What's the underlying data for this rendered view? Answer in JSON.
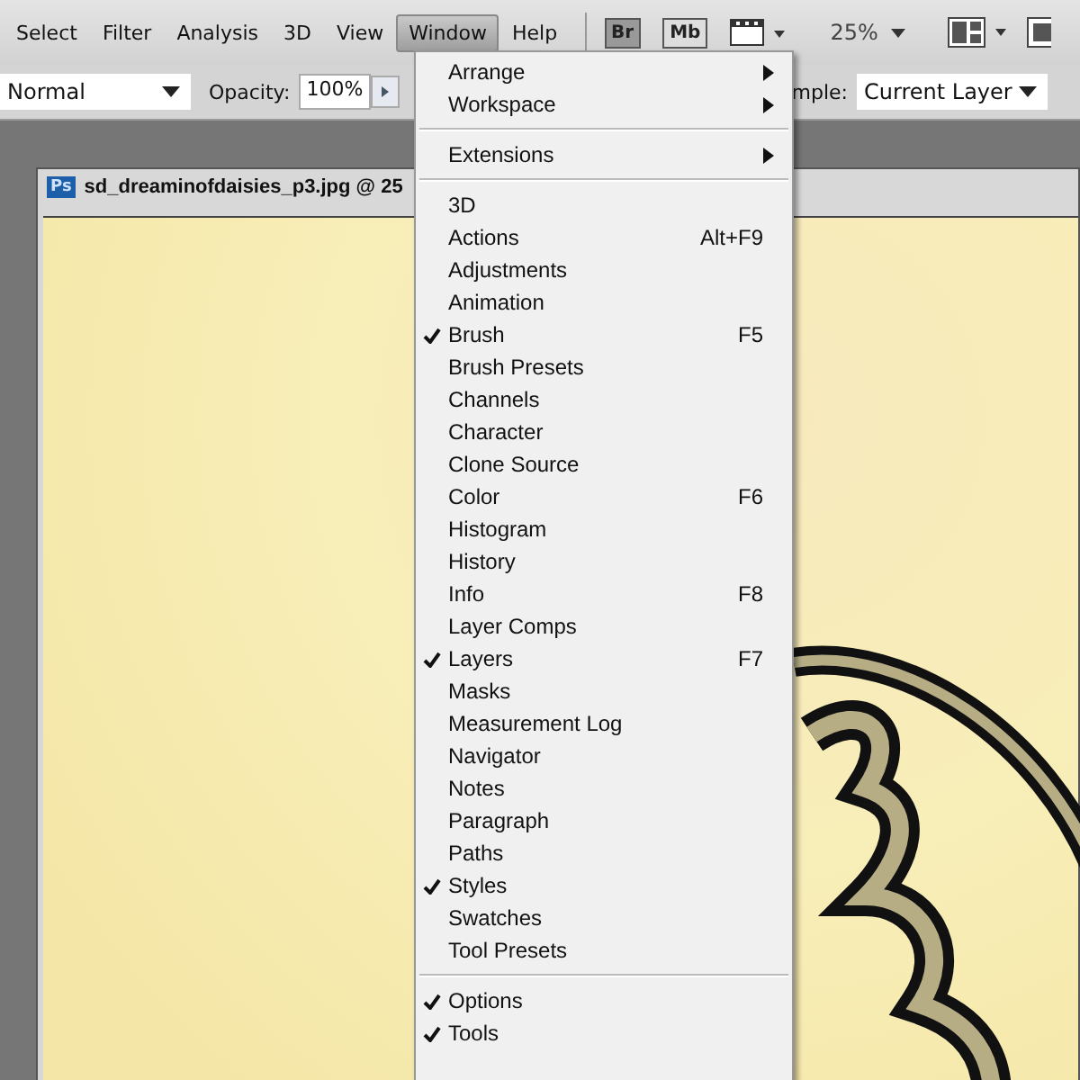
{
  "menubar": {
    "items": [
      {
        "label": "Select",
        "selected": false
      },
      {
        "label": "Filter",
        "selected": false
      },
      {
        "label": "Analysis",
        "selected": false
      },
      {
        "label": "3D",
        "selected": false
      },
      {
        "label": "View",
        "selected": false
      },
      {
        "label": "Window",
        "selected": true
      },
      {
        "label": "Help",
        "selected": false
      }
    ],
    "app_buttons": [
      "Br",
      "Mb"
    ],
    "zoom": "25%"
  },
  "options_bar": {
    "blend_mode": "Normal",
    "opacity_label": "Opacity:",
    "opacity": "100%",
    "sample_label": "mple:",
    "sample": "Current Layer"
  },
  "document": {
    "title": "sd_dreaminofdaisies_p3.jpg @ 25",
    "app_badge": "Ps"
  },
  "window_menu": {
    "items": [
      {
        "kind": "submenu",
        "label": "Arrange",
        "checked": false
      },
      {
        "kind": "submenu",
        "label": "Workspace",
        "checked": false
      },
      {
        "kind": "separator"
      },
      {
        "kind": "submenu",
        "label": "Extensions",
        "checked": false
      },
      {
        "kind": "separator"
      },
      {
        "kind": "item",
        "label": "3D",
        "checked": false
      },
      {
        "kind": "item",
        "label": "Actions",
        "shortcut": "Alt+F9",
        "checked": false
      },
      {
        "kind": "item",
        "label": "Adjustments",
        "checked": false
      },
      {
        "kind": "item",
        "label": "Animation",
        "checked": false
      },
      {
        "kind": "item",
        "label": "Brush",
        "shortcut": "F5",
        "checked": true
      },
      {
        "kind": "item",
        "label": "Brush Presets",
        "checked": false
      },
      {
        "kind": "item",
        "label": "Channels",
        "checked": false
      },
      {
        "kind": "item",
        "label": "Character",
        "checked": false
      },
      {
        "kind": "item",
        "label": "Clone Source",
        "checked": false
      },
      {
        "kind": "item",
        "label": "Color",
        "shortcut": "F6",
        "checked": false
      },
      {
        "kind": "item",
        "label": "Histogram",
        "checked": false
      },
      {
        "kind": "item",
        "label": "History",
        "checked": false
      },
      {
        "kind": "item",
        "label": "Info",
        "shortcut": "F8",
        "checked": false
      },
      {
        "kind": "item",
        "label": "Layer Comps",
        "checked": false
      },
      {
        "kind": "item",
        "label": "Layers",
        "shortcut": "F7",
        "checked": true
      },
      {
        "kind": "item",
        "label": "Masks",
        "checked": false
      },
      {
        "kind": "item",
        "label": "Measurement Log",
        "checked": false
      },
      {
        "kind": "item",
        "label": "Navigator",
        "checked": false
      },
      {
        "kind": "item",
        "label": "Notes",
        "checked": false
      },
      {
        "kind": "item",
        "label": "Paragraph",
        "checked": false
      },
      {
        "kind": "item",
        "label": "Paths",
        "checked": false
      },
      {
        "kind": "item",
        "label": "Styles",
        "checked": true
      },
      {
        "kind": "item",
        "label": "Swatches",
        "checked": false
      },
      {
        "kind": "item",
        "label": "Tool Presets",
        "checked": false
      },
      {
        "kind": "separator"
      },
      {
        "kind": "item",
        "label": "Options",
        "checked": true
      },
      {
        "kind": "item",
        "label": "Tools",
        "checked": true
      }
    ]
  }
}
